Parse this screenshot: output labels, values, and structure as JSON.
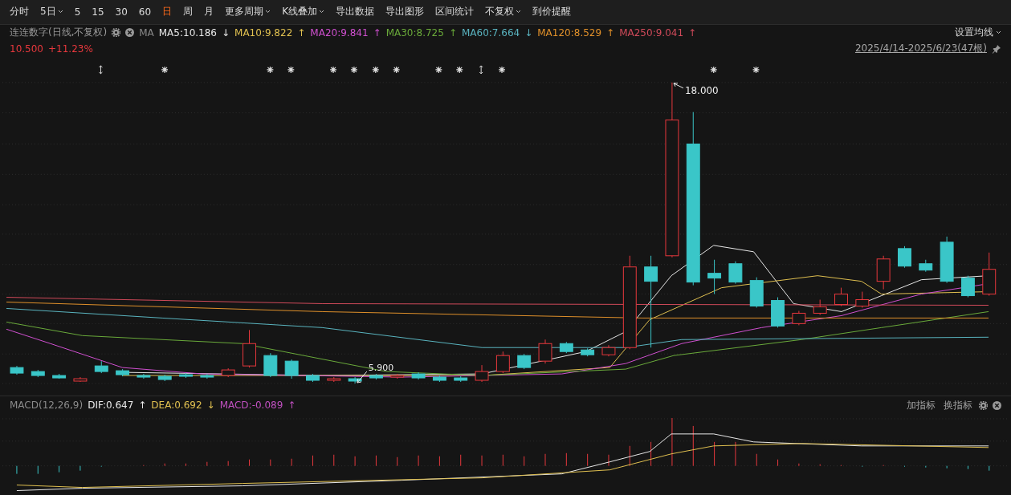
{
  "toolbar": {
    "items": [
      {
        "label": "分时",
        "dropdown": false,
        "selected": false
      },
      {
        "label": "5日",
        "dropdown": true,
        "selected": false
      },
      {
        "label": "5",
        "dropdown": false,
        "selected": false
      },
      {
        "label": "15",
        "dropdown": false,
        "selected": false
      },
      {
        "label": "30",
        "dropdown": false,
        "selected": false
      },
      {
        "label": "60",
        "dropdown": false,
        "selected": false
      },
      {
        "label": "日",
        "dropdown": false,
        "selected": true
      },
      {
        "label": "周",
        "dropdown": false,
        "selected": false
      },
      {
        "label": "月",
        "dropdown": false,
        "selected": false
      },
      {
        "label": "更多周期",
        "dropdown": true,
        "selected": false
      },
      {
        "label": "K线叠加",
        "dropdown": true,
        "selected": false
      },
      {
        "label": "导出数据",
        "dropdown": false,
        "selected": false
      },
      {
        "label": "导出图形",
        "dropdown": false,
        "selected": false
      },
      {
        "label": "区间统计",
        "dropdown": false,
        "selected": false
      },
      {
        "label": "不复权",
        "dropdown": true,
        "selected": false
      },
      {
        "label": "到价提醒",
        "dropdown": false,
        "selected": false
      }
    ]
  },
  "info": {
    "title": "连连数字(日线,不复权)",
    "ma_label": "MA",
    "settings": "设置均线",
    "averages": [
      {
        "label": "MA5:10.186",
        "arrow": "↓",
        "color": "#e8e8e8"
      },
      {
        "label": "MA10:9.822",
        "arrow": "↑",
        "color": "#e0c050"
      },
      {
        "label": "MA20:9.841",
        "arrow": "↑",
        "color": "#d050d0"
      },
      {
        "label": "MA30:8.725",
        "arrow": "↑",
        "color": "#6aaa3a"
      },
      {
        "label": "MA60:7.664",
        "arrow": "↓",
        "color": "#5ab4c0"
      },
      {
        "label": "MA120:8.529",
        "arrow": "↑",
        "color": "#e0902a"
      },
      {
        "label": "MA250:9.041",
        "arrow": "↑",
        "color": "#d04a5a"
      }
    ]
  },
  "quote": {
    "price": "10.500",
    "change": "+11.23%",
    "range": "2025/4/14-2025/6/23(47根)"
  },
  "chart": {
    "high_label": "18.000",
    "low_label": "5.900"
  },
  "macd": {
    "title": "MACD(12,26,9)",
    "values": [
      {
        "label": "DIF:0.647",
        "arrow": "↑",
        "color": "#e8e8e8"
      },
      {
        "label": "DEA:0.692",
        "arrow": "↓",
        "color": "#e0c050"
      },
      {
        "label": "MACD:-0.089",
        "arrow": "↑",
        "color": "#c050c0"
      }
    ],
    "buttons": [
      "加指标",
      "换指标"
    ]
  }
}
